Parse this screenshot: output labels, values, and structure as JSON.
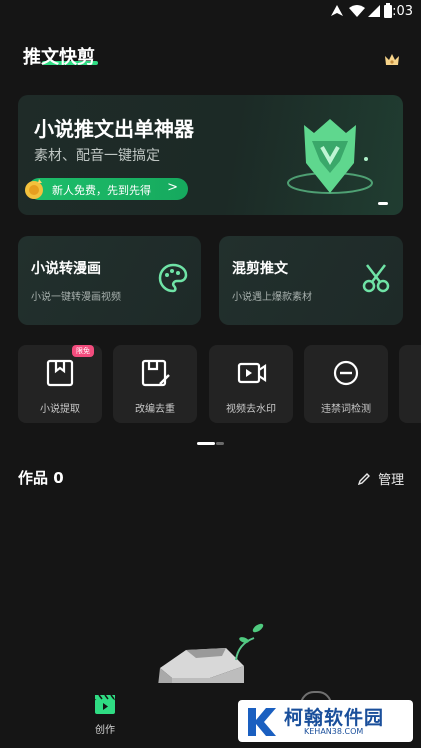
{
  "status_bar": {
    "time": "9:03"
  },
  "header": {
    "title": "推文快剪"
  },
  "banner": {
    "title": "小说推文出单神器",
    "subtitle": "素材、配音一键搞定",
    "cta": "新人免费，先到先得",
    "cta_arrow": ">"
  },
  "cards": [
    {
      "title": "小说转漫画",
      "subtitle": "小说一键转漫画视频",
      "icon": "palette-icon"
    },
    {
      "title": "混剪推文",
      "subtitle": "小说遇上爆款素材",
      "icon": "scissors-icon"
    }
  ],
  "tools": [
    {
      "label": "小说提取",
      "badge": "限免",
      "icon": "book-extract-icon"
    },
    {
      "label": "改编去重",
      "icon": "edit-doc-icon"
    },
    {
      "label": "视频去水印",
      "icon": "video-camera-icon"
    },
    {
      "label": "违禁词检测",
      "icon": "minus-circle-icon"
    }
  ],
  "works": {
    "title": "作品 0",
    "manage": "管理"
  },
  "nav": {
    "create": "创作"
  },
  "watermark": {
    "name": "柯翰软件园",
    "url": "KEHAN38.COM"
  },
  "colors": {
    "accent": "#2fdc83",
    "background": "#151515",
    "card": "#232323",
    "badge": "#f24c7d"
  }
}
